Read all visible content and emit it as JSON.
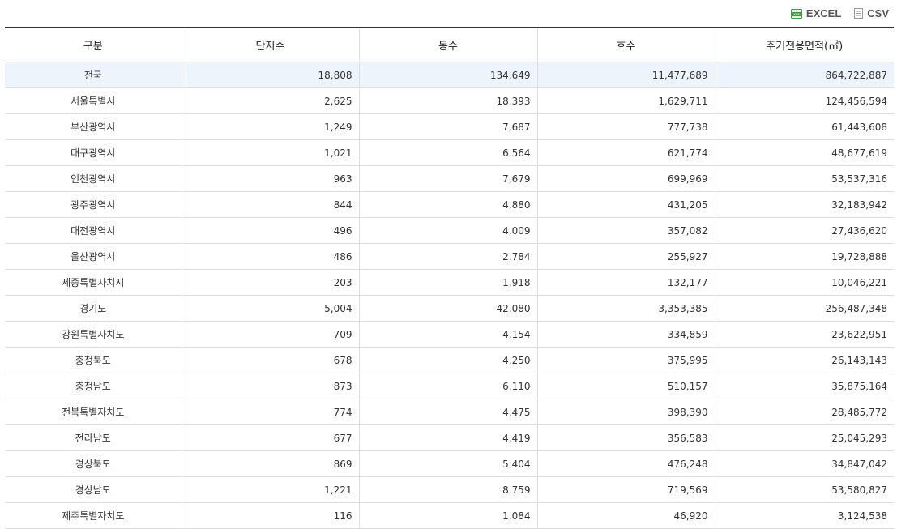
{
  "toolbar": {
    "excel_label": "EXCEL",
    "csv_label": "CSV",
    "excel_icon": "excel-file-icon",
    "csv_icon": "document-icon"
  },
  "colors": {
    "total_row_bg": "#eef4fb",
    "header_border": "#333333",
    "excel_green": "#3a9c3f"
  },
  "table": {
    "headers": [
      "구분",
      "단지수",
      "동수",
      "호수",
      "주거전용면적(㎡)"
    ],
    "rows": [
      [
        "전국",
        "18,808",
        "134,649",
        "11,477,689",
        "864,722,887"
      ],
      [
        "서울특별시",
        "2,625",
        "18,393",
        "1,629,711",
        "124,456,594"
      ],
      [
        "부산광역시",
        "1,249",
        "7,687",
        "777,738",
        "61,443,608"
      ],
      [
        "대구광역시",
        "1,021",
        "6,564",
        "621,774",
        "48,677,619"
      ],
      [
        "인천광역시",
        "963",
        "7,679",
        "699,969",
        "53,537,316"
      ],
      [
        "광주광역시",
        "844",
        "4,880",
        "431,205",
        "32,183,942"
      ],
      [
        "대전광역시",
        "496",
        "4,009",
        "357,082",
        "27,436,620"
      ],
      [
        "울산광역시",
        "486",
        "2,784",
        "255,927",
        "19,728,888"
      ],
      [
        "세종특별자치시",
        "203",
        "1,918",
        "132,177",
        "10,046,221"
      ],
      [
        "경기도",
        "5,004",
        "42,080",
        "3,353,385",
        "256,487,348"
      ],
      [
        "강원특별자치도",
        "709",
        "4,154",
        "334,859",
        "23,622,951"
      ],
      [
        "충청북도",
        "678",
        "4,250",
        "375,995",
        "26,143,143"
      ],
      [
        "충청남도",
        "873",
        "6,110",
        "510,157",
        "35,875,164"
      ],
      [
        "전북특별자치도",
        "774",
        "4,475",
        "398,390",
        "28,485,772"
      ],
      [
        "전라남도",
        "677",
        "4,419",
        "356,583",
        "25,045,293"
      ],
      [
        "경상북도",
        "869",
        "5,404",
        "476,248",
        "34,847,042"
      ],
      [
        "경상남도",
        "1,221",
        "8,759",
        "719,569",
        "53,580,827"
      ],
      [
        "제주특별자치도",
        "116",
        "1,084",
        "46,920",
        "3,124,538"
      ]
    ]
  }
}
